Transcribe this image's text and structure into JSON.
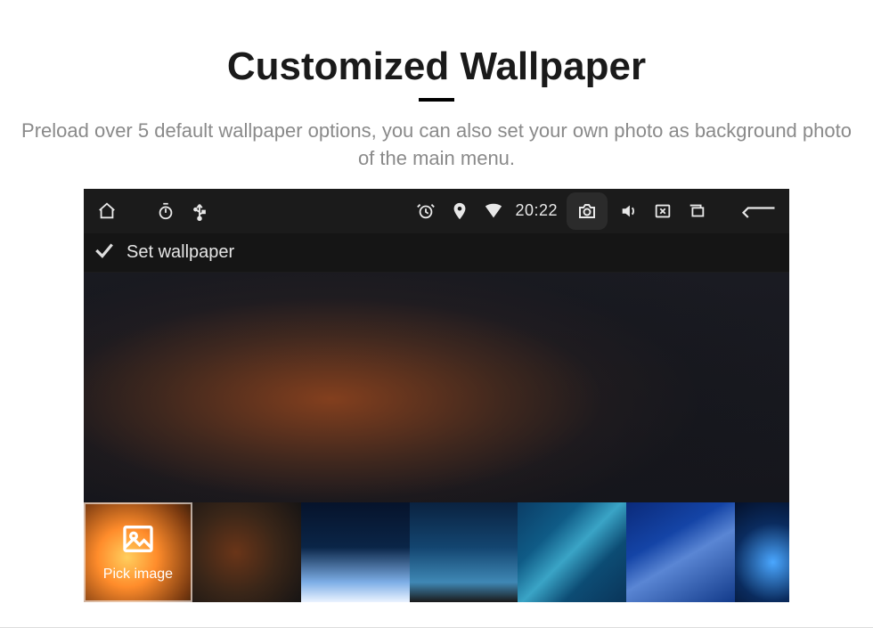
{
  "heading": "Customized Wallpaper",
  "subtitle": "Preload over 5 default wallpaper options, you can also set your own photo as background photo of the main menu.",
  "statusbar": {
    "time": "20:22",
    "icons": {
      "home": "home-icon",
      "stopwatch": "stopwatch-icon",
      "usb": "usb-icon",
      "alarm": "alarm-icon",
      "location": "location-icon",
      "wifi": "wifi-icon",
      "camera": "camera-icon",
      "volume": "volume-icon",
      "close_window": "close-window-icon",
      "recent": "recent-apps-icon",
      "back": "back-icon"
    }
  },
  "titlebar": {
    "title": "Set wallpaper",
    "confirm_icon": "confirm-check-icon"
  },
  "thumbs": {
    "pick_label": "Pick image",
    "items": [
      {
        "name": "pick-image",
        "selected": true
      },
      {
        "name": "wallpaper-2",
        "selected": false
      },
      {
        "name": "wallpaper-3",
        "selected": false
      },
      {
        "name": "wallpaper-4",
        "selected": false
      },
      {
        "name": "wallpaper-5",
        "selected": false
      },
      {
        "name": "wallpaper-6",
        "selected": false
      },
      {
        "name": "wallpaper-7",
        "selected": false
      }
    ]
  }
}
